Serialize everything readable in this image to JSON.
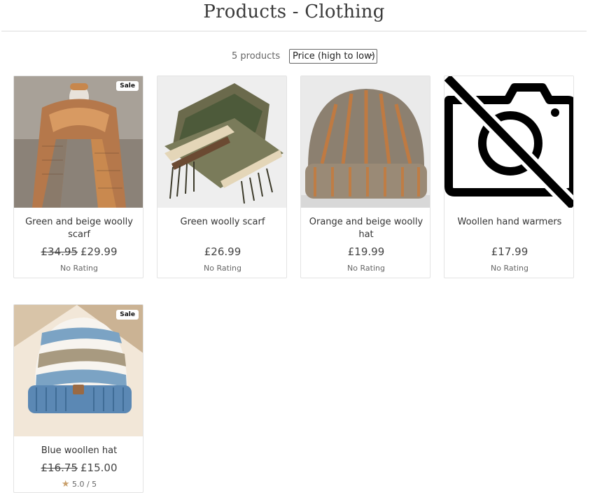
{
  "page": {
    "title": "Products - Clothing"
  },
  "toolbar": {
    "count": "5 products",
    "sort_selected": "Price (high to low)"
  },
  "products": [
    {
      "name": "Green and beige woolly scarf",
      "old_price": "£34.95",
      "price": "£29.99",
      "rating": "No Rating",
      "badge": "Sale",
      "image": "orange-scarf-image"
    },
    {
      "name": "Green woolly scarf",
      "old_price": "",
      "price": "£26.99",
      "rating": "No Rating",
      "badge": "",
      "image": "green-scarf-image"
    },
    {
      "name": "Orange and beige woolly hat",
      "old_price": "",
      "price": "£19.99",
      "rating": "No Rating",
      "badge": "",
      "image": "orange-hat-image"
    },
    {
      "name": "Woollen hand warmers",
      "old_price": "",
      "price": "£17.99",
      "rating": "No Rating",
      "badge": "",
      "image": "no-photo-icon"
    },
    {
      "name": "Blue woollen hat",
      "old_price": "£16.75",
      "price": "£15.00",
      "rating": "5.0 / 5",
      "badge": "Sale",
      "image": "blue-hat-image"
    }
  ]
}
